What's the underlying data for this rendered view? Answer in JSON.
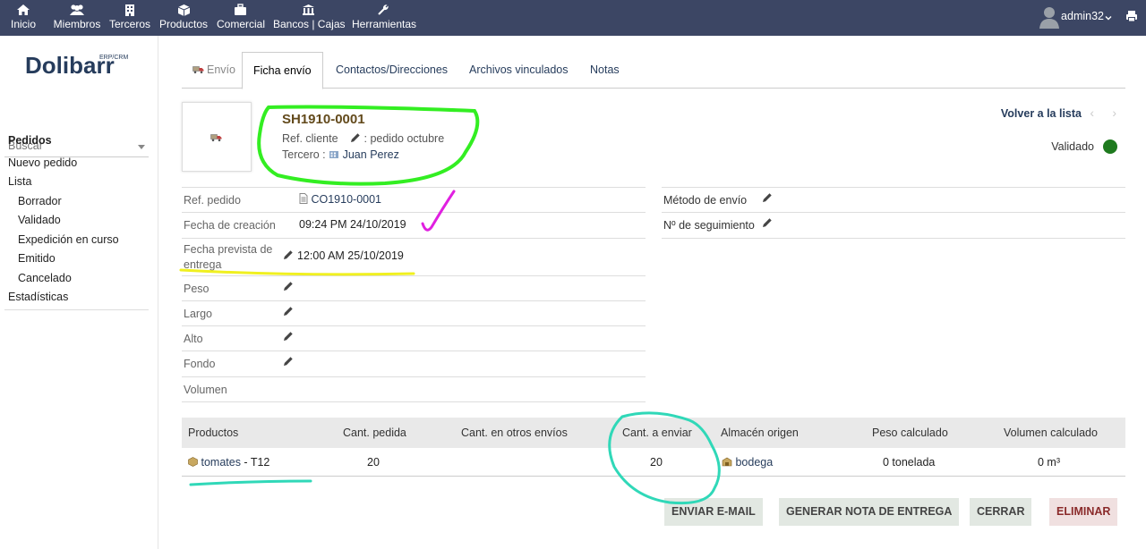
{
  "topbar": {
    "menus": [
      {
        "label": "Inicio",
        "icon": "home-icon"
      },
      {
        "label": "Miembros",
        "icon": "users-icon"
      },
      {
        "label": "Terceros",
        "icon": "building-icon"
      },
      {
        "label": "Productos",
        "icon": "cube-icon"
      },
      {
        "label": "Comercial",
        "icon": "briefcase-icon"
      },
      {
        "label": "Bancos | Cajas",
        "icon": "bank-icon"
      },
      {
        "label": "Herramientas",
        "icon": "wrench-icon"
      }
    ],
    "username": "admin32",
    "bar_color": "#3c4664"
  },
  "sidebar": {
    "logo_text": "Dolibarr",
    "logo_sub": "ERP/CRM",
    "search_placeholder": "Buscar",
    "items": [
      {
        "label": "Pedidos",
        "level": 0,
        "bold": true
      },
      {
        "label": "Nuevo pedido",
        "level": 0
      },
      {
        "label": "Lista",
        "level": 0
      },
      {
        "label": "Borrador",
        "level": 1
      },
      {
        "label": "Validado",
        "level": 1
      },
      {
        "label": "Expedición en curso",
        "level": 1
      },
      {
        "label": "Emitido",
        "level": 1
      },
      {
        "label": "Cancelado",
        "level": 1
      },
      {
        "label": "Estadísticas",
        "level": 0
      }
    ]
  },
  "tabs": [
    {
      "label": "Envío",
      "active": false
    },
    {
      "label": "Ficha envío",
      "active": true
    },
    {
      "label": "Contactos/Direcciones",
      "active": false
    },
    {
      "label": "Archivos vinculados",
      "active": false
    },
    {
      "label": "Notas",
      "active": false
    }
  ],
  "header": {
    "ref": "SH1910-0001",
    "ref_client_label": "Ref. cliente",
    "ref_client_value": ": pedido octubre",
    "third_party_label": "Tercero :",
    "third_party_value": "Juan Perez",
    "back_to_list": "Volver a la lista",
    "status": "Validado",
    "status_color": "#1e7a1e"
  },
  "fields_left": {
    "ref_order_label": "Ref. pedido",
    "ref_order_value": "CO1910-0001",
    "creation_date_label": "Fecha de creación",
    "creation_date_value": "09:24 PM 24/10/2019",
    "delivery_date_label": "Fecha prevista de entrega",
    "delivery_date_value": "12:00 AM 25/10/2019",
    "weight_label": "Peso",
    "length_label": "Largo",
    "height_label": "Alto",
    "depth_label": "Fondo",
    "volume_label": "Volumen"
  },
  "fields_right": {
    "shipping_method_label": "Método de envío",
    "tracking_label": "Nº de seguimiento"
  },
  "products": {
    "headers": {
      "product": "Productos",
      "qty_ordered": "Cant. pedida",
      "qty_other": "Cant. en otros envíos",
      "qty_to_ship": "Cant. a enviar",
      "warehouse": "Almacén origen",
      "weight": "Peso calculado",
      "volume": "Volumen calculado"
    },
    "rows": [
      {
        "product_link": "tomates",
        "product_desc": " - T12",
        "qty_ordered": "20",
        "qty_other": "",
        "qty_to_ship": "20",
        "warehouse": "bodega",
        "weight": "0 tonelada",
        "volume": "0 m³"
      }
    ]
  },
  "buttons": {
    "send_email": "Enviar e-mail",
    "generate_note": "Generar nota de entrega",
    "close": "Cerrar",
    "delete": "Eliminar"
  }
}
